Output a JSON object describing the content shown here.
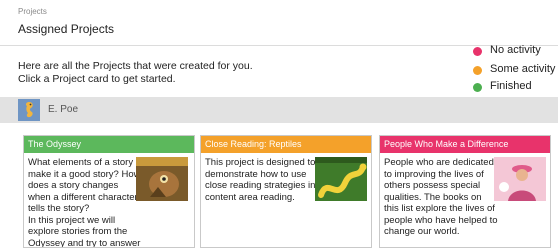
{
  "header": {
    "breadcrumb": "Projects",
    "title": "Assigned Projects"
  },
  "intro": {
    "line1": "Here are all the Projects that were created for you.",
    "line2": "Click a Project card to get started."
  },
  "legend": [
    {
      "label": "No activity",
      "color": "#e8336b"
    },
    {
      "label": "Some activity",
      "color": "#f4a12a"
    },
    {
      "label": "Finished",
      "color": "#4caf50"
    }
  ],
  "user": {
    "name": "E. Poe",
    "avatar_icon": "seahorse-avatar"
  },
  "cards": [
    {
      "title": "The Odyssey",
      "color": "#5cb85c",
      "lines": [
        "What elements of a story",
        "make it a good story? How",
        "does a story changes",
        "when a different character",
        "tells the story?",
        "In this project we will",
        "explore stories from the",
        "Odyssey and try to answer"
      ],
      "thumbnail": "cyclops-book-cover"
    },
    {
      "title": "Close Reading: Reptiles",
      "color": "#f4a12a",
      "lines": [
        "This project is designed to",
        "demonstrate how to use",
        "close reading strategies in",
        "content area reading."
      ],
      "thumbnail": "snake-book-cover"
    },
    {
      "title": "People Who Make a Difference",
      "color": "#e8336b",
      "lines": [
        "People who are dedicated",
        "to improving the lives of",
        "others possess special",
        "qualities. The books on",
        "this list explore the lives of",
        "people who have helped to",
        "change our world."
      ],
      "thumbnail": "person-book-cover"
    }
  ]
}
